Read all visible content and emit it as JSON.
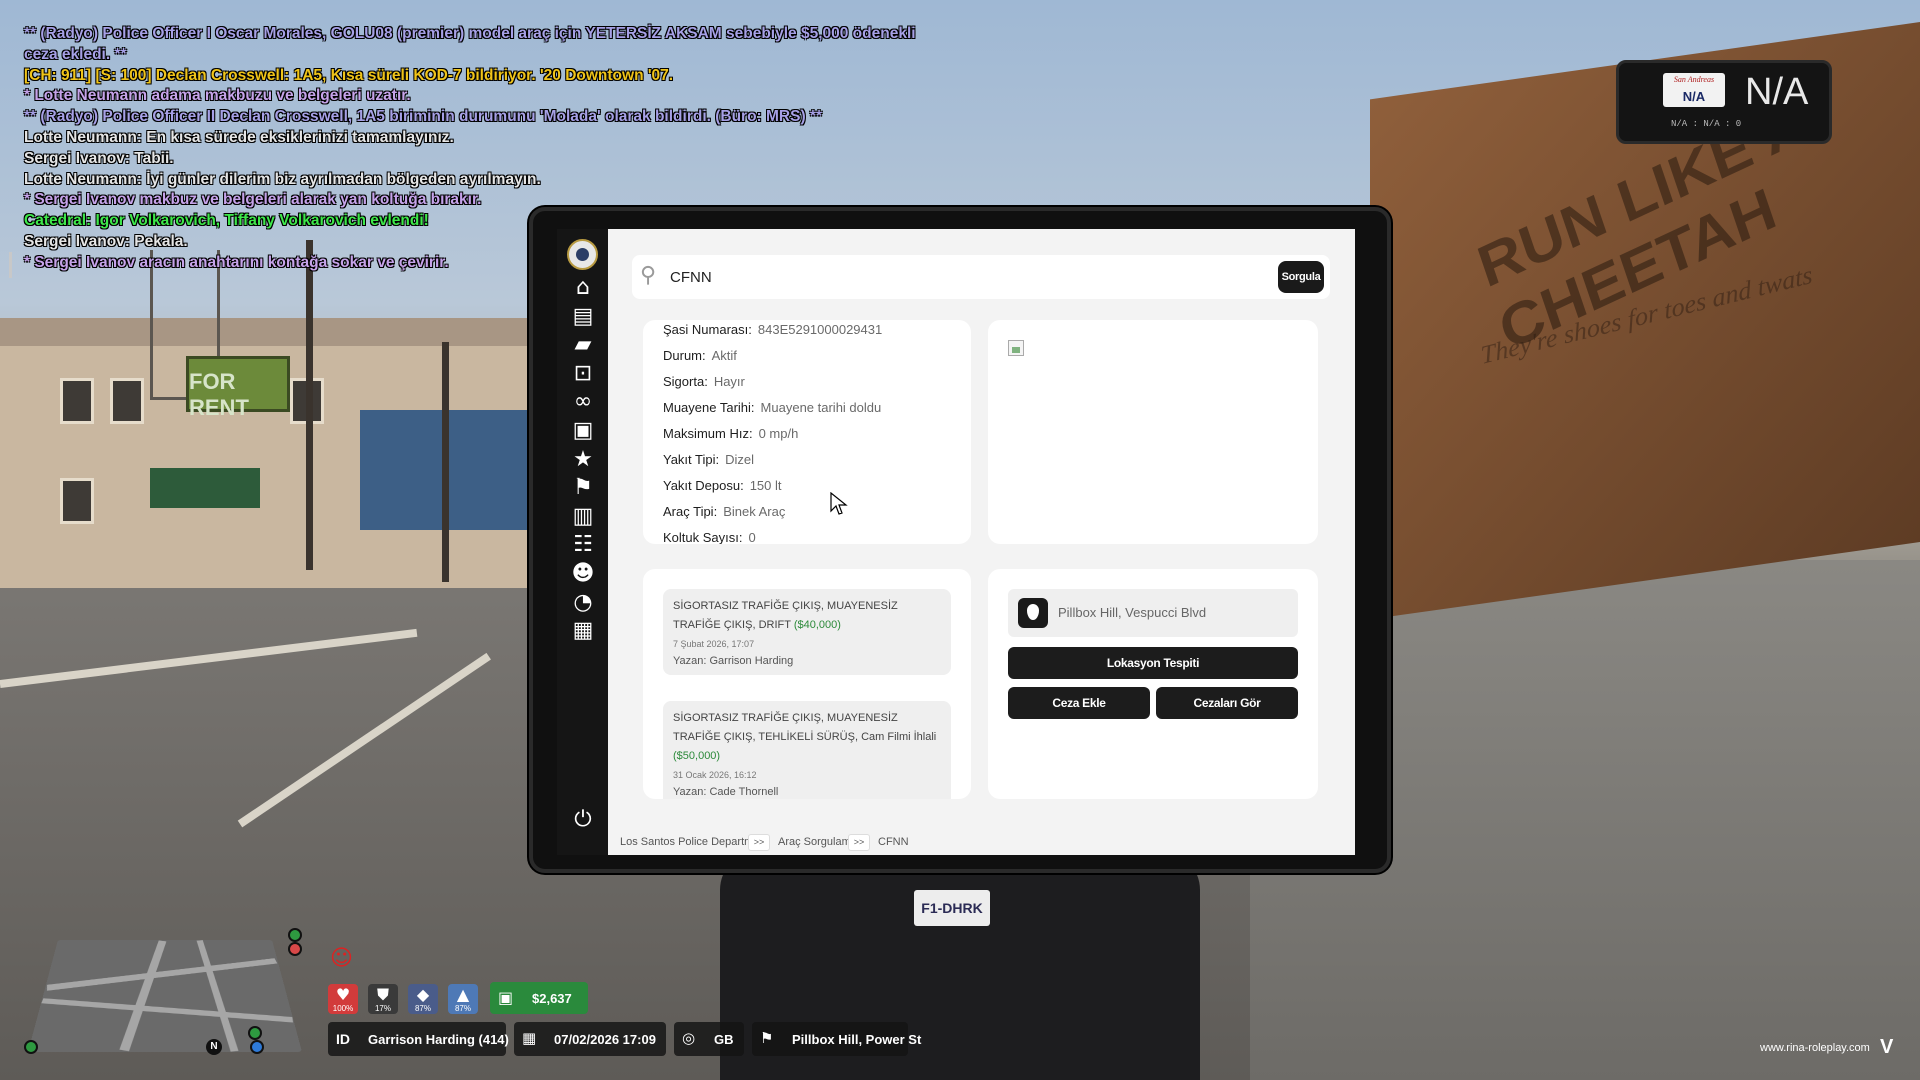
{
  "chat": {
    "lines": [
      {
        "text": "** (Radyo) Police Officer I Oscar Morales, GOLU08 (premier) model araç için YETERSİZ AKSAM sebebiyle $5,000 ödenekli",
        "color": "#a6a0e6"
      },
      {
        "text": "ceza ekledi. **",
        "color": "#a6a0e6"
      },
      {
        "text": "[CH: 911] [S: 100] Declan Crosswell: 1A5, Kısa süreli KOD-7 bildiriyor. '20 Downtown '07.",
        "color": "#f0c419"
      },
      {
        "text": "* Lotte Neumann adama makbuzu ve belgeleri uzatır.",
        "color": "#c6a3ea"
      },
      {
        "text": "** (Radyo) Police Officer II Declan Crosswell, 1A5 biriminin durumunu 'Molada' olarak bildirdi. (Büro: MRS) **",
        "color": "#a6a0e6"
      },
      {
        "text": "Lotte Neumann: En kısa sürede eksiklerinizi tamamlayınız.",
        "color": "#e6e6e6"
      },
      {
        "text": "Sergei Ivanov: Tabii.",
        "color": "#e6e6e6"
      },
      {
        "text": "Lotte Neumann: İyi günler dilerim biz ayrılmadan bölgeden ayrılmayın.",
        "color": "#e6e6e6"
      },
      {
        "text": "* Sergei Ivanov makbuz ve belgeleri alarak yan koltuğa bırakır.",
        "color": "#c6a3ea"
      },
      {
        "text": "Catedral: Igor Volkarovich, Tiffany Volkarovich evlendi!",
        "color": "#3ee84a"
      },
      {
        "text": "Sergei Ivanov: Pekala.",
        "color": "#e6e6e6"
      },
      {
        "text": "* Sergei Ivanov aracın anahtarını kontağa sokar ve çevirir.",
        "color": "#c6a3ea"
      }
    ]
  },
  "dashcam": {
    "plate_state": "San Andreas",
    "plate_text": "N/A",
    "big_text": "N/A",
    "small_text": "N/A : N/A : 0"
  },
  "tablet": {
    "search": {
      "value": "CFNN",
      "button": "Sorgula"
    },
    "sidebar_icons": [
      "home-icon",
      "document-icon",
      "folder-open-icon",
      "lock-icon",
      "binoculars-icon",
      "briefcase-icon",
      "star-icon",
      "flag-icon",
      "clipboard-icon",
      "users-icon",
      "user-icon",
      "speedometer-icon",
      "archive-icon",
      "power-icon"
    ],
    "vehicle_info": [
      {
        "label": "Şasi Numarası:",
        "value": "843E5291000029431"
      },
      {
        "label": "Durum:",
        "value": "Aktif"
      },
      {
        "label": "Sigorta:",
        "value": "Hayır"
      },
      {
        "label": "Muayene Tarihi:",
        "value": "Muayene tarihi doldu"
      },
      {
        "label": "Maksimum Hız:",
        "value": "0 mp/h"
      },
      {
        "label": "Yakıt Tipi:",
        "value": "Dizel"
      },
      {
        "label": "Yakıt Deposu:",
        "value": "150 lt"
      },
      {
        "label": "Araç Tipi:",
        "value": "Binek Araç"
      },
      {
        "label": "Koltuk Sayısı:",
        "value": "0"
      }
    ],
    "fines": [
      {
        "title": "SİGORTASIZ TRAFİĞE ÇIKIŞ, MUAYENESİZ TRAFİĞE ÇIKIŞ, DRIFT",
        "amount": "($40,000)",
        "date": "7 Şubat 2026, 17:07",
        "author": "Yazan: Garrison Harding"
      },
      {
        "title": "SİGORTASIZ TRAFİĞE ÇIKIŞ, MUAYENESİZ TRAFİĞE ÇIKIŞ, TEHLİKELİ SÜRÜŞ, Cam Filmi İhlali",
        "amount": "($50,000)",
        "date": "31 Ocak 2026, 16:12",
        "author": "Yazan: Cade Thornell"
      }
    ],
    "location": {
      "text": "Pillbox Hill, Vespucci Blvd",
      "detect_button": "Lokasyon Tespiti",
      "add_fine_button": "Ceza Ekle",
      "view_fines_button": "Cezaları Gör"
    },
    "breadcrumb": {
      "root": "Los Santos Police Department",
      "sep": ">>",
      "section": "Araç Sorgulama",
      "current": "CFNN"
    }
  },
  "hud": {
    "stats": [
      {
        "icon": "heart-icon",
        "glyph": "♥",
        "value": "100%",
        "color": "#d23b3b"
      },
      {
        "icon": "armor-icon",
        "glyph": "⛊",
        "value": "17%",
        "color": "#3a3a3a"
      },
      {
        "icon": "food-icon",
        "glyph": "◆",
        "value": "87%",
        "color": "#4a5c8a"
      },
      {
        "icon": "water-icon",
        "glyph": "▲",
        "value": "87%",
        "color": "#4e79b6"
      }
    ],
    "money": "$2,637",
    "id_label": "ID",
    "player": "Garrison Harding (414)",
    "datetime": "07/02/2026 17:09",
    "compass": "GB",
    "location": "Pillbox Hill, Power St",
    "minimap_north": "N",
    "watermark": "www.rina-roleplay.com"
  },
  "scenery": {
    "billboard": "RUN LIKE A CHEETAH",
    "billboard_sub": "They're shoes for toes and twats",
    "small_sign": "FOR RENT",
    "car_plate": "F1-DHRK"
  }
}
